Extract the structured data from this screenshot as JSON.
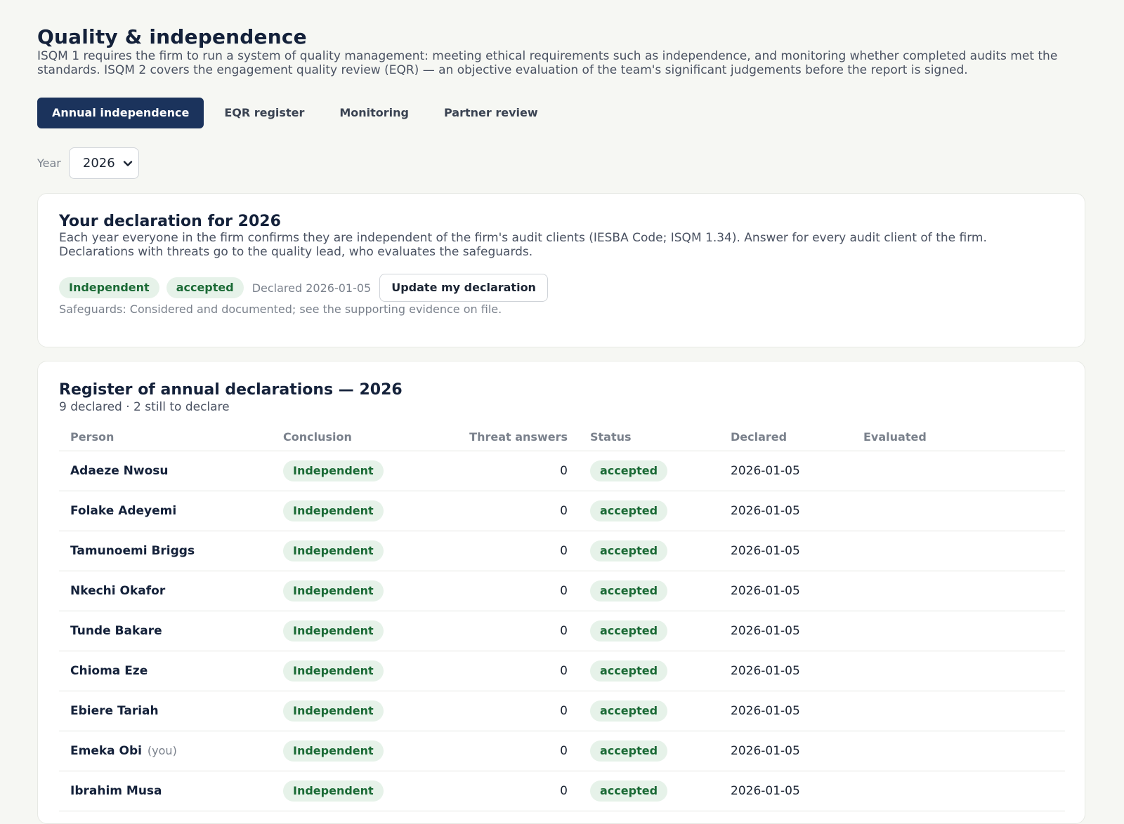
{
  "header": {
    "title": "Quality & independence",
    "intro": "ISQM 1 requires the firm to run a system of quality management: meeting ethical requirements such as independence, and monitoring whether completed audits met the standards. ISQM 2 covers the engagement quality review (EQR) — an objective evaluation of the team's significant judgements before the report is signed."
  },
  "tabs": [
    {
      "label": "Annual independence",
      "active": true
    },
    {
      "label": "EQR register",
      "active": false
    },
    {
      "label": "Monitoring",
      "active": false
    },
    {
      "label": "Partner review",
      "active": false
    }
  ],
  "year": {
    "label": "Year",
    "value": "2026"
  },
  "declaration": {
    "title": "Your declaration for 2026",
    "description": "Each year everyone in the firm confirms they are independent of the firm's audit clients (IESBA Code; ISQM 1.34). Answer for every audit client of the firm. Declarations with threats go to the quality lead, who evaluates the safeguards.",
    "conclusion": "Independent",
    "status": "accepted",
    "declared": "Declared 2026-01-05",
    "update_button": "Update my declaration",
    "safeguards": "Safeguards: Considered and documented; see the supporting evidence on file."
  },
  "register": {
    "title": "Register of annual declarations — 2026",
    "summary": "9 declared · 2 still to declare",
    "columns": [
      "Person",
      "Conclusion",
      "Threat answers",
      "Status",
      "Declared",
      "Evaluated"
    ],
    "rows": [
      {
        "person": "Adaeze Nwosu",
        "you": "",
        "conclusion": "Independent",
        "threats": "0",
        "status": "accepted",
        "declared": "2026-01-05",
        "evaluated": ""
      },
      {
        "person": "Folake Adeyemi",
        "you": "",
        "conclusion": "Independent",
        "threats": "0",
        "status": "accepted",
        "declared": "2026-01-05",
        "evaluated": ""
      },
      {
        "person": "Tamunoemi Briggs",
        "you": "",
        "conclusion": "Independent",
        "threats": "0",
        "status": "accepted",
        "declared": "2026-01-05",
        "evaluated": ""
      },
      {
        "person": "Nkechi Okafor",
        "you": "",
        "conclusion": "Independent",
        "threats": "0",
        "status": "accepted",
        "declared": "2026-01-05",
        "evaluated": ""
      },
      {
        "person": "Tunde Bakare",
        "you": "",
        "conclusion": "Independent",
        "threats": "0",
        "status": "accepted",
        "declared": "2026-01-05",
        "evaluated": ""
      },
      {
        "person": "Chioma Eze",
        "you": "",
        "conclusion": "Independent",
        "threats": "0",
        "status": "accepted",
        "declared": "2026-01-05",
        "evaluated": ""
      },
      {
        "person": "Ebiere Tariah",
        "you": "",
        "conclusion": "Independent",
        "threats": "0",
        "status": "accepted",
        "declared": "2026-01-05",
        "evaluated": ""
      },
      {
        "person": "Emeka Obi",
        "you": "(you)",
        "conclusion": "Independent",
        "threats": "0",
        "status": "accepted",
        "declared": "2026-01-05",
        "evaluated": ""
      },
      {
        "person": "Ibrahim Musa",
        "you": "",
        "conclusion": "Independent",
        "threats": "0",
        "status": "accepted",
        "declared": "2026-01-05",
        "evaluated": ""
      }
    ]
  },
  "icons": {
    "year_select": "chevron-down-icon"
  },
  "colors": {
    "accent": "#1b335c",
    "badge_bg": "#e6f2e9",
    "badge_text": "#1a6a35"
  }
}
